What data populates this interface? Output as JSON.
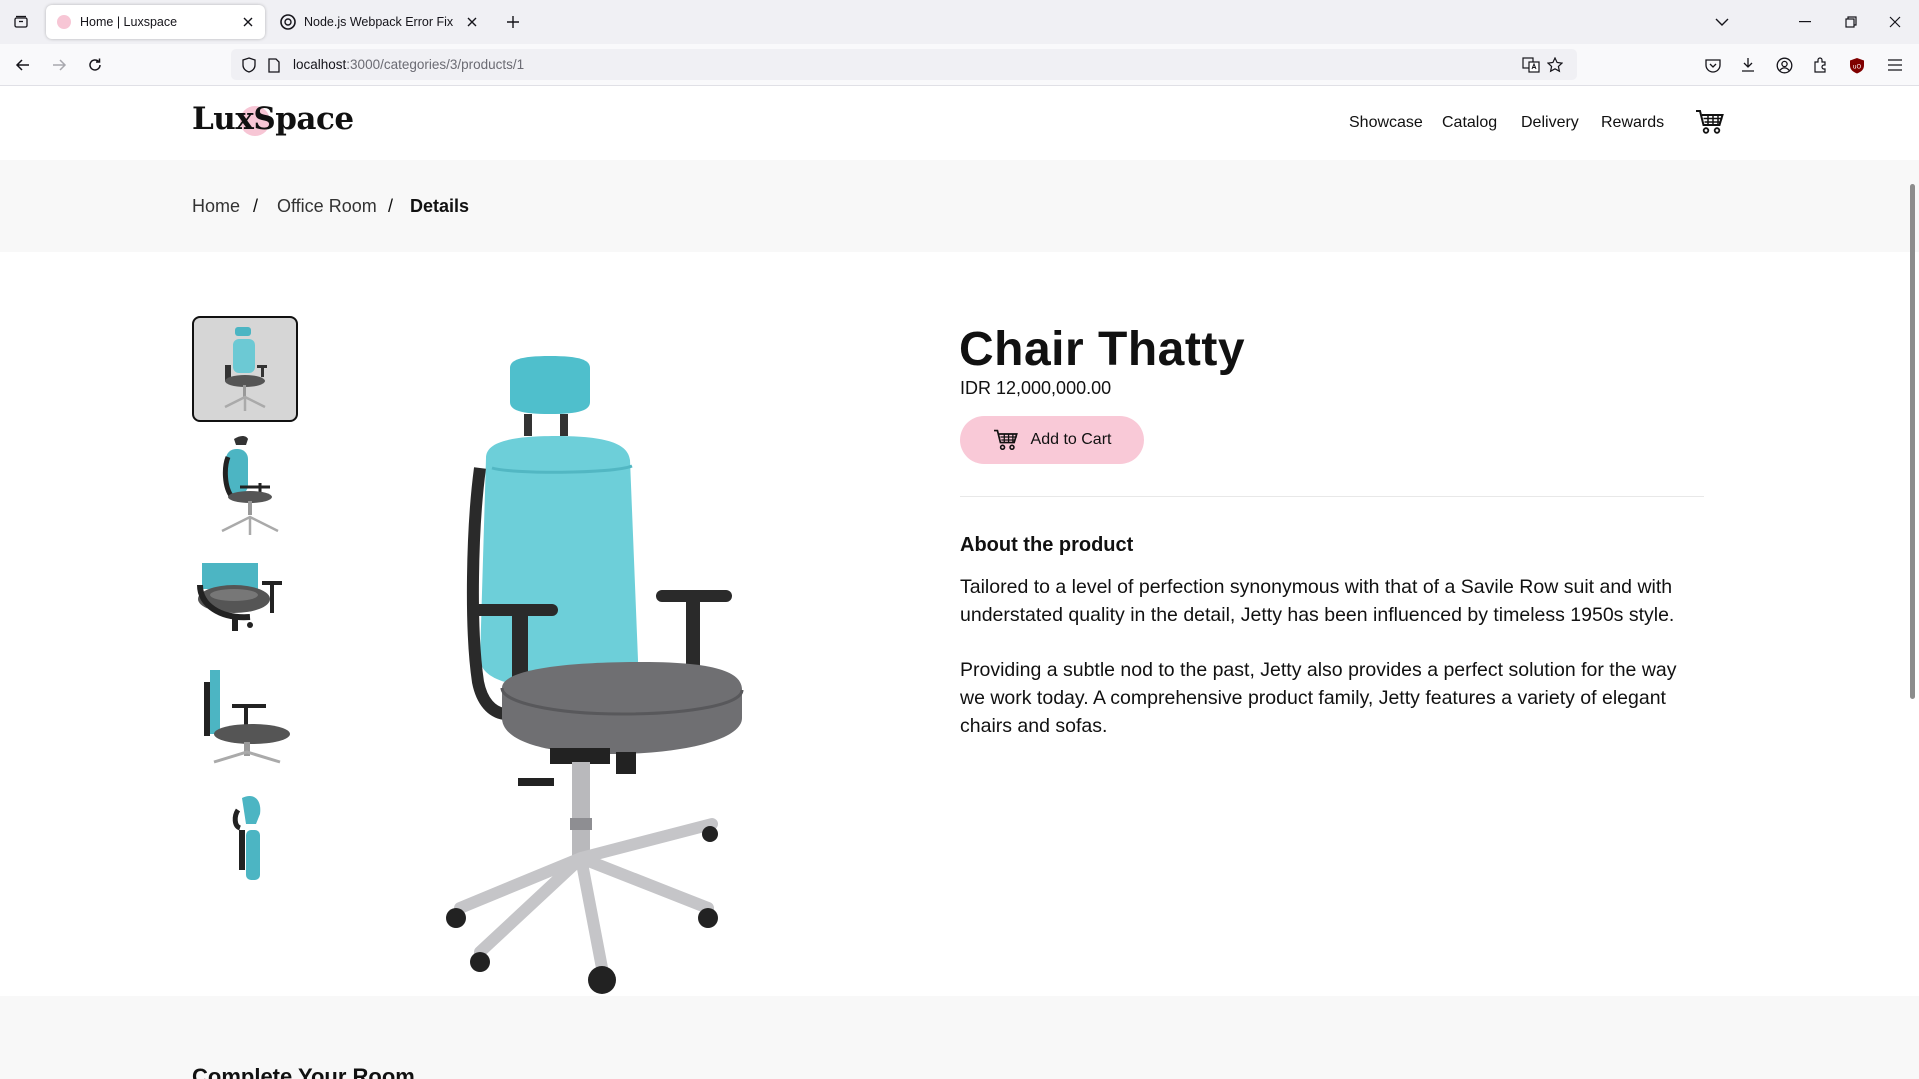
{
  "browser": {
    "tabs": [
      {
        "title": "Home | Luxspace",
        "active": true
      },
      {
        "title": "Node.js Webpack Error Fix",
        "active": false
      }
    ],
    "url": {
      "host": "localhost",
      "path": ":3000/categories/3/products/1"
    }
  },
  "site": {
    "logo_prefix": "Lux",
    "logo_suffix": "Space",
    "menu": [
      "Showcase",
      "Catalog",
      "Delivery",
      "Rewards"
    ],
    "accent_color": "#f9c9d7"
  },
  "breadcrumb": {
    "items": [
      "Home",
      "Office Room",
      "Details"
    ],
    "separator": "/"
  },
  "product": {
    "name": "Chair Thatty",
    "price": "IDR 12,000,000.00",
    "add_to_cart_label": "Add to Cart",
    "about_heading": "About the product",
    "paragraphs": [
      "Tailored to a level of perfection synonymous with that of a Savile Row suit and with understated quality in the detail, Jetty has been influenced by timeless 1950s style.",
      "Providing a subtle nod to the past, Jetty also provides a perfect solution for the way we work today. A comprehensive product family, Jetty features a variety of elegant chairs and sofas."
    ]
  },
  "section_next": {
    "title": "Complete Your Room"
  }
}
